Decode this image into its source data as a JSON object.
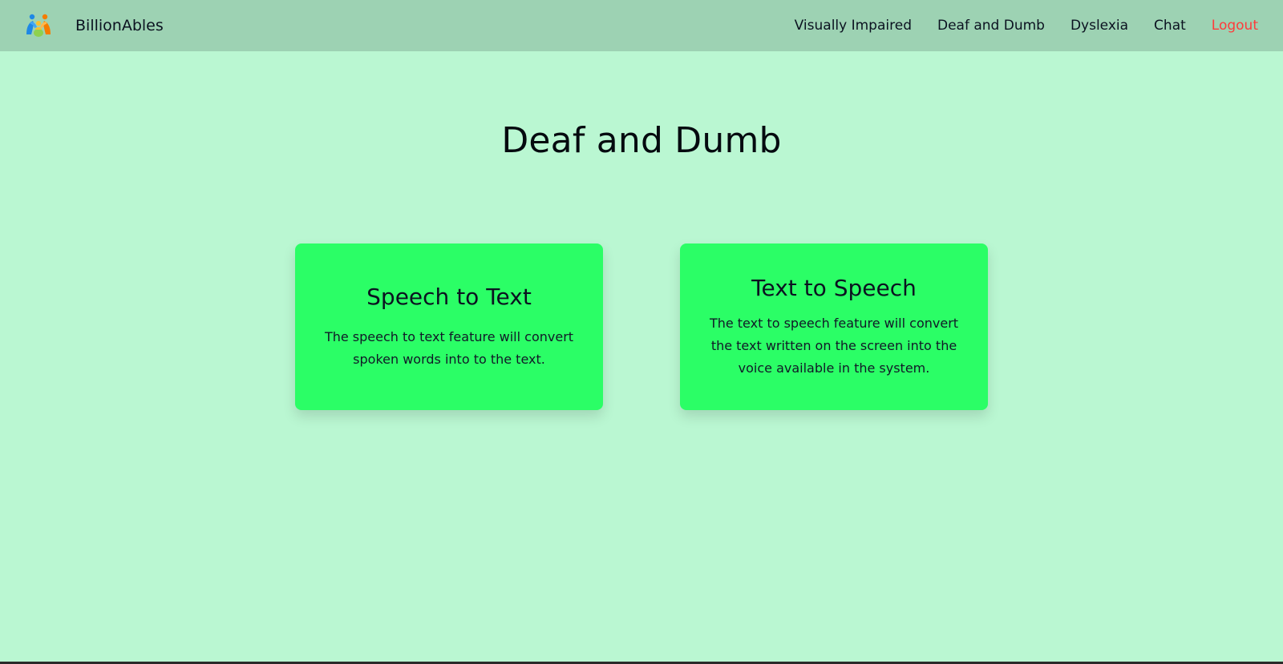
{
  "navbar": {
    "brand_name": "BillionAbles",
    "logo_icon": "people-logo-icon",
    "links": [
      {
        "label": "Visually Impaired"
      },
      {
        "label": "Deaf and Dumb"
      },
      {
        "label": "Dyslexia"
      },
      {
        "label": "Chat"
      },
      {
        "label": "Logout"
      }
    ]
  },
  "page": {
    "title": "Deaf and Dumb"
  },
  "cards": [
    {
      "title": "Speech to Text",
      "description": "The speech to text feature will convert spoken words into to the text."
    },
    {
      "title": "Text to Speech",
      "description": "The text to speech feature will convert the text written on the screen into the voice available in the system."
    }
  ],
  "colors": {
    "background": "#baf7d2",
    "navbar": "#9dd2b3",
    "card": "#2bfe66",
    "logout": "#ff3b3b"
  }
}
